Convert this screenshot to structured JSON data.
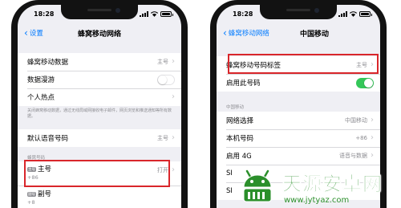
{
  "colors": {
    "accent": "#007aff",
    "toggle_on": "#34c759",
    "highlight": "#d9262b",
    "watermark": "#2b8f2b"
  },
  "left_phone": {
    "status": {
      "time": "18:28"
    },
    "nav": {
      "back_label": "设置",
      "title": "蜂窝移动网络"
    },
    "group1": [
      {
        "label": "蜂窝移动数据",
        "value": "主号"
      },
      {
        "label": "数据漫游",
        "toggle": "off"
      },
      {
        "label": "个人热点"
      }
    ],
    "footnote": "关闭蜂窝移动数据，通过无线局域网接收电子邮件，网页浏览和推送通知等所有数据。",
    "group2": [
      {
        "label": "默认语音号码",
        "value": "主号"
      }
    ],
    "section_header": "蜂窝号码",
    "lines": [
      {
        "badge": "主号",
        "name": "主号",
        "number": "+86",
        "status": "打开"
      },
      {
        "badge": "副号",
        "name": "副号",
        "number": "+8"
      }
    ]
  },
  "right_phone": {
    "status": {
      "time": "18:28"
    },
    "nav": {
      "back_label": "蜂窝移动网络",
      "title": "中国移动"
    },
    "group1": [
      {
        "label": "蜂窝移动号码标签",
        "value": "主号"
      },
      {
        "label": "启用此号码",
        "toggle": "on"
      }
    ],
    "section_header": "中国移动",
    "group2": [
      {
        "label": "网络选择",
        "value": "中国移动"
      },
      {
        "label": "本机号码",
        "value": "+86"
      },
      {
        "label": "启用 4G",
        "value": "语音与数据"
      },
      {
        "label": "SI"
      },
      {
        "label": "SI"
      }
    ]
  },
  "watermark": {
    "title": "天源安卓网",
    "url": "www.jytyaz.com",
    "icon": "android-logo-icon"
  }
}
